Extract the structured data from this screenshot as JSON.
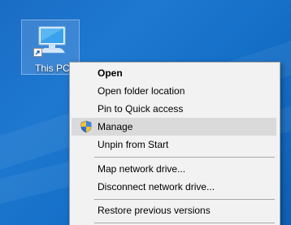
{
  "desktop": {
    "icon_label": "This PC",
    "icon_name": "computer-icon"
  },
  "context_menu": {
    "items": [
      {
        "label": "Open",
        "bold": true
      },
      {
        "label": "Open folder location"
      },
      {
        "label": "Pin to Quick access"
      },
      {
        "label": "Manage",
        "icon": "uac-shield-icon",
        "highlighted": true
      },
      {
        "label": "Unpin from Start"
      },
      {
        "label": "Map network drive..."
      },
      {
        "label": "Disconnect network drive..."
      },
      {
        "label": "Restore previous versions"
      }
    ]
  }
}
